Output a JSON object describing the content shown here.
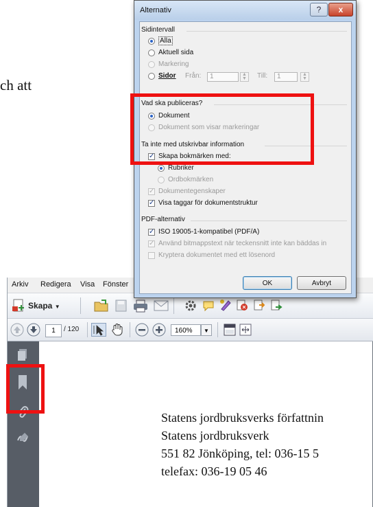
{
  "background_doc_fragment": "ch att",
  "dialog": {
    "title": "Alternativ",
    "help_btn": "?",
    "close_btn": "x",
    "sidintervall": {
      "label": "Sidintervall",
      "options": [
        "Alla",
        "Aktuell sida",
        "Markering"
      ],
      "sidor_label": "Sidor",
      "fran_label": "Från:",
      "fran_value": "1",
      "till_label": "Till:",
      "till_value": "1"
    },
    "publish": {
      "label": "Vad ska publiceras?",
      "options": [
        "Dokument",
        "Dokument som visar markeringar"
      ]
    },
    "nonprint": {
      "label": "Ta inte med utskrivbar information",
      "items": [
        "Skapa bokmärken med:",
        "Rubriker",
        "Ordbokmärken",
        "Dokumentegenskaper",
        "Visa taggar för dokumentstruktur"
      ]
    },
    "pdf": {
      "label": "PDF-alternativ",
      "items": [
        "ISO 19005-1-kompatibel (PDF/A)",
        "Använd bitmappstext när teckensnitt inte kan bäddas in",
        "Kryptera dokumentet med ett lösenord"
      ]
    },
    "ok_label": "OK",
    "cancel_label": "Avbryt"
  },
  "acrobat": {
    "menu": [
      "Arkiv",
      "Redigera",
      "Visa",
      "Fönster"
    ],
    "create_label": "Skapa",
    "page_current": "1",
    "page_total": "/ 120",
    "zoom": "160%",
    "page_lines": [
      "Statens jordbruksverks författnin",
      "Statens jordbruksverk",
      "551 82  Jönköping, tel: 036-15 5",
      "telefax: 036-19 05 46"
    ]
  },
  "colors": {
    "highlight": "#ee1111",
    "nav_pane": "#575d66",
    "accent": "#2b63c6"
  }
}
